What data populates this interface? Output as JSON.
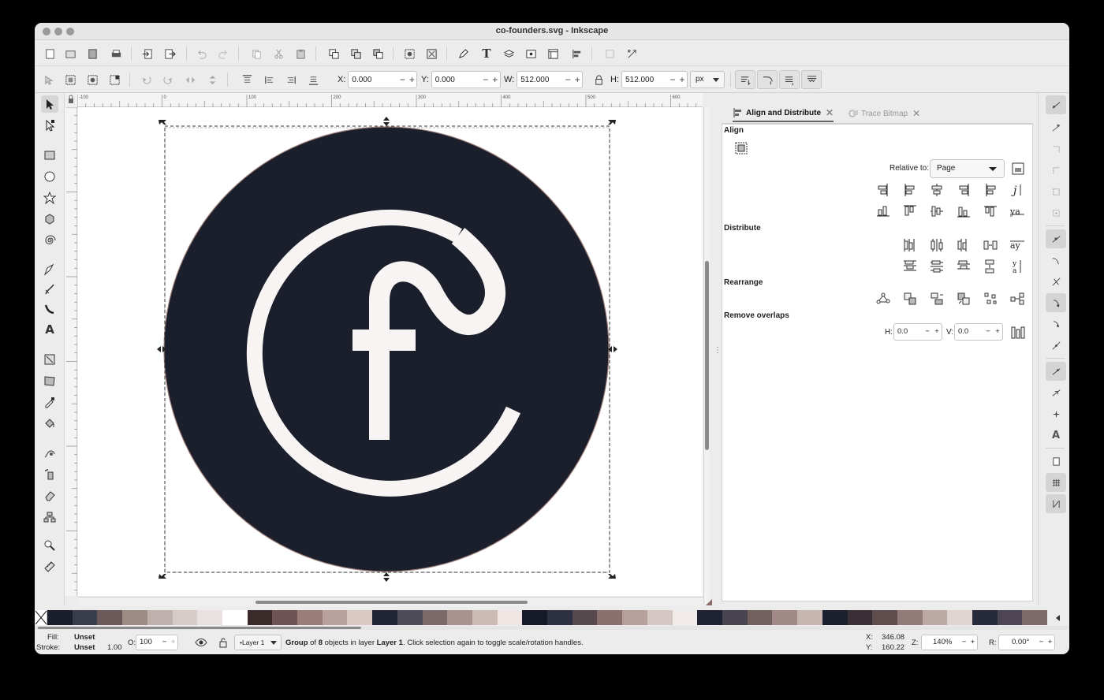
{
  "window": {
    "title": "co-founders.svg - Inkscape"
  },
  "controls": {
    "x": {
      "label": "X:",
      "value": "0.000"
    },
    "y": {
      "label": "Y:",
      "value": "0.000"
    },
    "w": {
      "label": "W:",
      "value": "512.000"
    },
    "h": {
      "label": "H:",
      "value": "512.000"
    },
    "unit": "px",
    "plus": "+",
    "minus": "−"
  },
  "ruler": {
    "h_labels": [
      "-100",
      "0",
      "100",
      "200",
      "300",
      "400",
      "500",
      "600"
    ]
  },
  "panel": {
    "tabs": [
      {
        "label": "Align and Distribute",
        "icon": "align-distribute-icon"
      },
      {
        "label": "Trace Bitmap",
        "icon": "trace-bitmap-icon"
      }
    ],
    "align_heading": "Align",
    "relative_to_label": "Relative to:",
    "relative_to_value": "Page",
    "distribute_heading": "Distribute",
    "rearrange_heading": "Rearrange",
    "remove_overlaps_heading": "Remove overlaps",
    "overlap_h_label": "H:",
    "overlap_h_value": "0.0",
    "overlap_v_label": "V:",
    "overlap_v_value": "0.0"
  },
  "palette": {
    "colors": [
      "#1b1e2b",
      "#3a3d4c",
      "#6b5858",
      "#9d8b86",
      "#bfb1ad",
      "#d7cbc8",
      "#e9e1df",
      "#ffffff",
      "#3b2a2a",
      "#6e5454",
      "#9a7d79",
      "#b9a19d",
      "#d9c8c4",
      "#202434",
      "#4e4c58",
      "#7b6a69",
      "#a99390",
      "#cbbab6",
      "#efe6e3",
      "#161a26",
      "#2d3040",
      "#574a4e",
      "#8a716f",
      "#b6a09c",
      "#d5c7c4",
      "#f1ebe9",
      "#1f2232",
      "#47434f",
      "#72605f",
      "#a08986",
      "#c7b5b1",
      "#1c1f2d",
      "#392f35",
      "#5f4c4d",
      "#927b78",
      "#bca9a5",
      "#e0d4d1",
      "#262a3a",
      "#4d4553",
      "#7e6b6a"
    ]
  },
  "status": {
    "fill_label": "Fill:",
    "fill_value": "Unset",
    "stroke_label": "Stroke:",
    "stroke_value": "Unset",
    "stroke_width": "1.00",
    "opacity_label": "O:",
    "opacity_value": "100",
    "layer": "•Layer 1",
    "message_bold1": "Group",
    "message_part2": " of ",
    "message_bold2": "8",
    "message_part3": " objects in layer ",
    "message_bold3": "Layer 1",
    "message_part4": ". Click selection again to toggle scale/rotation handles.",
    "x_label": "X:",
    "x_value": "346.08",
    "y_label": "Y:",
    "y_value": "160.22",
    "zoom_label": "Z:",
    "zoom_value": "140%",
    "rotation_label": "R:",
    "rotation_value": "0.00°"
  },
  "colors": {
    "logo_fill": "#1b1e2b",
    "logo_stroke": "#9b7f7a",
    "mark_fill": "#f7f4f3"
  }
}
